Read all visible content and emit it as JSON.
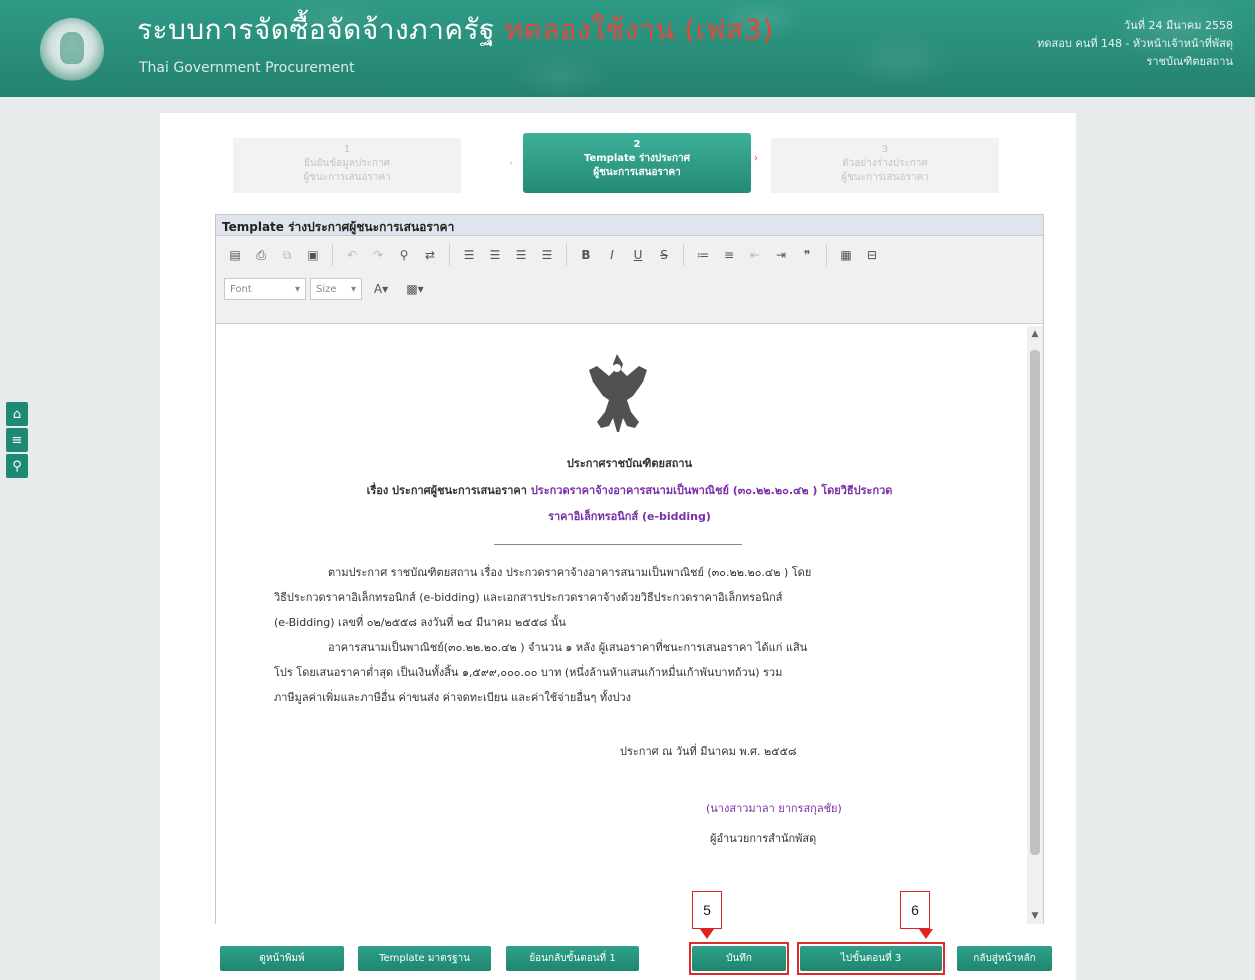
{
  "header": {
    "title_main": "ระบบการจัดซื้อจัดจ้างภาครัฐ",
    "title_tag": "ทดลองใช้งาน (เฟส3)",
    "subtitle": "Thai Government Procurement",
    "date": "วันที่ 24 มีนาคม 2558",
    "user": "ทดสอบ คนที่ 148 - หัวหน้าเจ้าหน้าที่พัสดุ",
    "org": "ราชบัณฑิตยสถาน"
  },
  "side_tools": [
    "home-icon",
    "menu-icon",
    "search-icon"
  ],
  "steps": [
    {
      "num": "1",
      "line1": "ยืนยันข้อมูลประกาศ",
      "line2": "ผู้ชนะการเสนอราคา"
    },
    {
      "num": "2",
      "line1": "Template ร่างประกาศ",
      "line2": "ผู้ชนะการเสนอราคา"
    },
    {
      "num": "3",
      "line1": "ตัวอย่างร่างประกาศ",
      "line2": "ผู้ชนะการเสนอราคา"
    }
  ],
  "template": {
    "title": "Template ร่างประกาศผู้ชนะการเสนอราคา",
    "font_label": "Font",
    "size_label": "Size"
  },
  "document": {
    "heading": "ประกาศราชบัณฑิตยสถาน",
    "subject_prefix": "เรื่อง ประกาศผู้ชนะการเสนอราคา",
    "subject_line1": "ประกวดราคาจ้างอาคารสนามเป็นพาณิชย์ (๓๐.๒๒.๒๐.๔๒ ) โดยวิธีประกวด",
    "subject_line2": "ราคาอิเล็กทรอนิกส์ (e-bidding)",
    "para1_line1": "ตามประกาศ ราชบัณฑิตยสถาน เรื่อง ประกวดราคาจ้างอาคารสนามเป็นพาณิชย์ (๓๐.๒๒.๒๐.๔๒ ) โดย",
    "para1_line2": "วิธีประกวดราคาอิเล็กทรอนิกส์ (e-bidding) และเอกสารประกวดราคาจ้างด้วยวิธีประกวดราคาอิเล็กทรอนิกส์",
    "para1_line3": "(e-Bidding) เลขที่ ๐๒/๒๕๕๘ ลงวันที่ ๒๔ มีนาคม ๒๕๕๘ นั้น",
    "para2_line1": "อาคารสนามเป็นพาณิชย์(๓๐.๒๒.๒๐.๔๒ ) จำนวน ๑ หลัง ผู้เสนอราคาที่ชนะการเสนอราคา ได้แก่ แสิน",
    "para2_line2": "โปร โดยเสนอราคาต่ำสุด เป็นเงินทั้งสิ้น ๑,๕๙๙,๐๐๐.๐๐ บาท (หนึ่งล้านห้าแสนเก้าหมื่นเก้าพันบาทถ้วน) รวม",
    "para2_line3": "ภาษีมูลค่าเพิ่มและภาษีอื่น ค่าขนส่ง ค่าจดทะเบียน และค่าใช้จ่ายอื่นๆ ทั้งปวง",
    "announce_date": "ประกาศ ณ วันที่   มีนาคม พ.ศ. ๒๕๕๘",
    "signer_name": "(นางสาวมาลา ยากรสกุลชัย)",
    "signer_title": "ผู้อำนวยการสำนักพัสดุ"
  },
  "buttons": {
    "preview": "ดูหน้าพิมพ์",
    "template_std": "Template มาตรฐาน",
    "back_step1": "ย้อนกลับขั้นตอนที่ 1",
    "save": "บันทึก",
    "next_step3": "ไปขั้นตอนที่ 3",
    "home": "กลับสู่หน้าหลัก"
  },
  "callouts": {
    "save": "5",
    "next": "6"
  },
  "colors": {
    "header": "#24836f",
    "button": "#1f8670",
    "callout": "#e02b2b",
    "accent_text": "#7a2fa8"
  }
}
